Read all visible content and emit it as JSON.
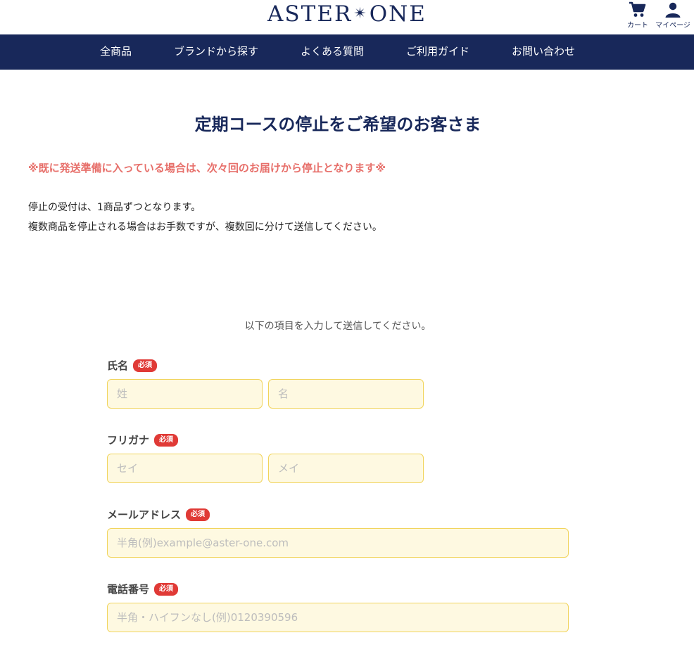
{
  "header": {
    "logo_left": "ASTER",
    "logo_star": "✴",
    "logo_right": "ONE",
    "cart_label": "カート",
    "mypage_label": "マイページ"
  },
  "nav": {
    "items": [
      "全商品",
      "ブランドから探す",
      "よくある質問",
      "ご利用ガイド",
      "お問い合わせ"
    ]
  },
  "content": {
    "title": "定期コースの停止をご希望のお客さま",
    "warning": "※既に発送準備に入っている場合は、次々回のお届けから停止となります※",
    "desc_line1": "停止の受付は、1商品ずつとなります。",
    "desc_line2": "複数商品を停止される場合はお手数ですが、複数回に分けて送信してください。",
    "intro": "以下の項目を入力して送信してください。"
  },
  "form": {
    "required_badge": "必須",
    "name": {
      "label": "氏名",
      "last_placeholder": "姓",
      "first_placeholder": "名",
      "last_value": "",
      "first_value": ""
    },
    "kana": {
      "label": "フリガナ",
      "last_placeholder": "セイ",
      "first_placeholder": "メイ",
      "last_value": "",
      "first_value": ""
    },
    "email": {
      "label": "メールアドレス",
      "placeholder": "半角(例)example@aster-one.com",
      "value": ""
    },
    "phone": {
      "label": "電話番号",
      "placeholder": "半角・ハイフンなし(例)0120390596",
      "value": ""
    }
  },
  "colors": {
    "brand_navy": "#18285a",
    "warning_red": "#e76f6a",
    "badge_red": "#e03a36",
    "input_bg": "#fef9e1",
    "input_border": "#f1d45c"
  }
}
